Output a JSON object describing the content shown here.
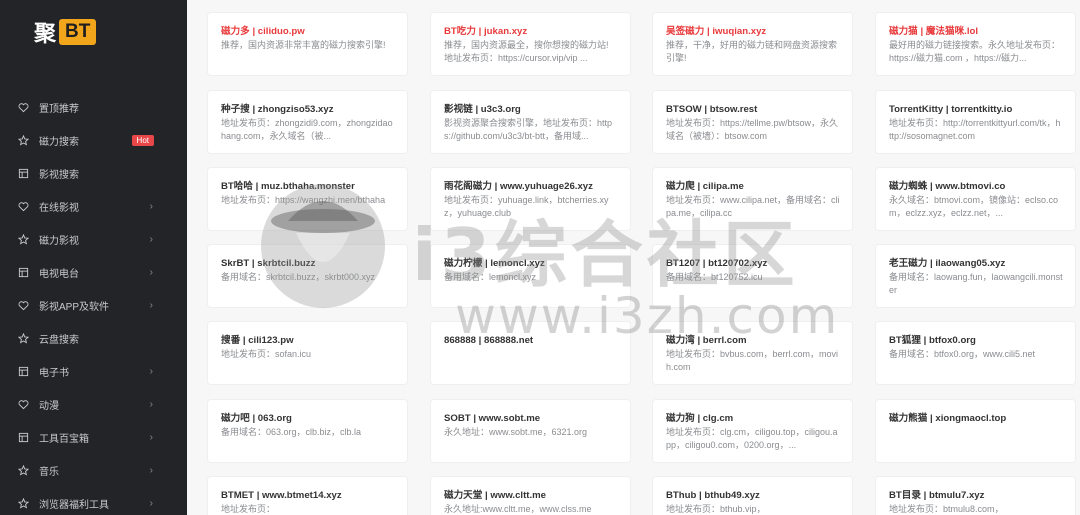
{
  "logo": {
    "text": "聚",
    "box": "BT"
  },
  "sidebar": {
    "items": [
      {
        "label": "置顶推荐",
        "icon": "heart-icon",
        "arrow": ""
      },
      {
        "label": "磁力搜索",
        "icon": "star-icon",
        "arrow": "",
        "badge": "Hot"
      },
      {
        "label": "影视搜索",
        "icon": "bars-icon",
        "arrow": ""
      },
      {
        "label": "在线影视",
        "icon": "heart-icon",
        "arrow": "›"
      },
      {
        "label": "磁力影视",
        "icon": "star-icon",
        "arrow": "›"
      },
      {
        "label": "电视电台",
        "icon": "bars-icon",
        "arrow": "›"
      },
      {
        "label": "影视APP及软件",
        "icon": "heart-icon",
        "arrow": "›"
      },
      {
        "label": "云盘搜索",
        "icon": "star-icon",
        "arrow": ""
      },
      {
        "label": "电子书",
        "icon": "bars-icon",
        "arrow": "›"
      },
      {
        "label": "动漫",
        "icon": "heart-icon",
        "arrow": "›"
      },
      {
        "label": "工具百宝箱",
        "icon": "bars-icon",
        "arrow": "›"
      },
      {
        "label": "音乐",
        "icon": "star-icon",
        "arrow": "›"
      },
      {
        "label": "浏览器福利工具",
        "icon": "star-icon",
        "arrow": "›"
      }
    ]
  },
  "cards": [
    {
      "title": "磁力多 | ciliduo.pw",
      "desc": "推荐，国内资源非常丰富的磁力搜索引擎!",
      "red": true
    },
    {
      "title": "BT吃力 | jukan.xyz",
      "desc": "推荐，国内资源最全，搜你想搜的磁力站! 地址发布页：https://cursor.vip/vip ...",
      "red": true
    },
    {
      "title": "吴签磁力 | iwuqian.xyz",
      "desc": "推荐，干净，好用的磁力链和网盘资源搜索引擎!",
      "red": true
    },
    {
      "title": "磁力猫 | 魔法猫咪.lol",
      "desc": "最好用的磁力链接搜索。永久地址发布页：https://磁力猫.com ，https://磁力...",
      "red": true
    },
    {
      "title": "种子搜 | zhongziso53.xyz",
      "desc": "地址发布页：zhongzidi9.com，zhongzidaohang.com，永久域名（被...",
      "red": false
    },
    {
      "title": "影视链 | u3c3.org",
      "desc": "影视资源聚合搜索引擎，地址发布页：https://github.com/u3c3/bt-btt，备用域...",
      "red": false
    },
    {
      "title": "BTSOW | btsow.rest",
      "desc": "地址发布页：https://tellme.pw/btsow，永久域名（被墙）：btsow.com",
      "red": false
    },
    {
      "title": "TorrentKitty | torrentkitty.io",
      "desc": "地址发布页：http://torrentkittyurl.com/tk，http://sosomagnet.com",
      "red": false
    },
    {
      "title": "BT哈哈 | muz.bthaha.monster",
      "desc": "地址发布页：https://wangzhi.men/bthaha",
      "red": false
    },
    {
      "title": "雨花阁磁力 | www.yuhuage26.xyz",
      "desc": "地址发布页：yuhuage.link，btcherries.xyz，yuhuage.club",
      "red": false
    },
    {
      "title": "磁力爬 | cilipa.me",
      "desc": "地址发布页：www.cilipa.net，备用域名：clipa.me，cilipa.cc",
      "red": false
    },
    {
      "title": "磁力蜘蛛 | www.btmovi.co",
      "desc": "永久域名：btmovi.com，镜像站：eclso.com，eclzz.xyz，eclzz.net，...",
      "red": false
    },
    {
      "title": "SkrBT | skrbtcil.buzz",
      "desc": "备用域名：skrbtcil.buzz，skrbt000.xyz",
      "red": false
    },
    {
      "title": "磁力柠檬 | lemoncl.xyz",
      "desc": "备用域名：lemoncl.xyz",
      "red": false
    },
    {
      "title": "BT1207 | bt120702.xyz",
      "desc": "备用域名：bt120752.icu",
      "red": false
    },
    {
      "title": "老王磁力 | ilaowang05.xyz",
      "desc": "备用域名：laowang.fun，laowangcili.monster",
      "red": false
    },
    {
      "title": "搜番 | cili123.pw",
      "desc": "地址发布页：sofan.icu",
      "red": false
    },
    {
      "title": "868888 | 868888.net",
      "desc": "",
      "red": false
    },
    {
      "title": "磁力湾 | berrl.com",
      "desc": "地址发布页：bvbus.com，berrl.com，movih.com",
      "red": false
    },
    {
      "title": "BT狐狸 | btfox0.org",
      "desc": "备用域名：btfox0.org，www.cili5.net",
      "red": false
    },
    {
      "title": "磁力吧 | 063.org",
      "desc": "备用域名：063.org，clb.biz，clb.la",
      "red": false
    },
    {
      "title": "SOBT | www.sobt.me",
      "desc": "永久地址：www.sobt.me，6321.org",
      "red": false
    },
    {
      "title": "磁力狗 | clg.cm",
      "desc": "地址发布页：clg.cm，ciligou.top，ciligou.app，ciligou0.com，0200.org，...",
      "red": false
    },
    {
      "title": "磁力熊猫 | xiongmaocl.top",
      "desc": "",
      "red": false
    },
    {
      "title": "BTMET | www.btmet14.xyz",
      "desc": "地址发布页：",
      "red": false
    },
    {
      "title": "磁力天堂 | www.cltt.me",
      "desc": "永久地址:www.cltt.me，www.clss.me",
      "red": false
    },
    {
      "title": "BThub | bthub49.xyz",
      "desc": "地址发布页：bthub.vip，",
      "red": false
    },
    {
      "title": "BT目录 | btmulu7.xyz",
      "desc": "地址发布页：btmulu8.com，",
      "red": false
    }
  ],
  "watermark": {
    "text": "i3综合社区",
    "url": "www.i3zh.com"
  },
  "colors": {
    "sidebar_bg": "#232427",
    "accent": "#f1a51b",
    "hot": "#e8474a",
    "red_title": "#e8393b"
  }
}
